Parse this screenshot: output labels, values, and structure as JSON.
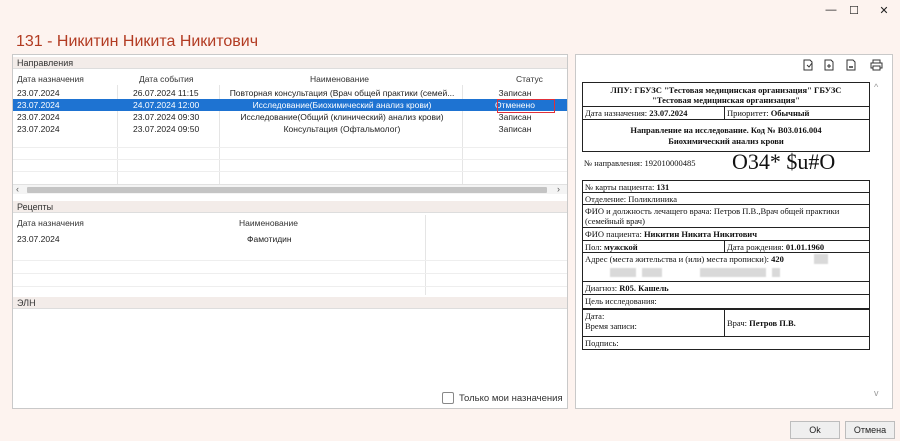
{
  "window": {
    "minimize_icon": "—",
    "maximize_icon": "☐",
    "close_icon": "✕"
  },
  "page_title": "131 - Никитин Никита Никитович",
  "referrals": {
    "section_title": "Направления",
    "columns": [
      "Дата назначения",
      "Дата события",
      "Наименование",
      "Статус"
    ],
    "rows": [
      {
        "assigned": "23.07.2024",
        "event": "26.07.2024 11:15",
        "name": "Повторная консультация (Врач общей практики (семей...",
        "status": "Записан"
      },
      {
        "assigned": "23.07.2024",
        "event": "24.07.2024 12:00",
        "name": "Исследование(Биохимический анализ крови)",
        "status": "Отменено"
      },
      {
        "assigned": "23.07.2024",
        "event": "23.07.2024 09:30",
        "name": "Исследование(Общий (клинический) анализ крови)",
        "status": "Записан"
      },
      {
        "assigned": "23.07.2024",
        "event": "23.07.2024 09:50",
        "name": "Консультация (Офтальмолог)",
        "status": "Записан"
      }
    ],
    "selected_row": 1
  },
  "prescriptions": {
    "section_title": "Рецепты",
    "columns": [
      "Дата назначения",
      "Наименование"
    ],
    "rows": [
      {
        "assigned": "23.07.2024",
        "name": "Фамотидин"
      }
    ]
  },
  "eln": {
    "section_title": "ЭЛН"
  },
  "only_mine_label": "Только мои назначения",
  "toolbar_icons": [
    "document-icon",
    "export-icon",
    "export-alt-icon",
    "print-icon"
  ],
  "document": {
    "lpu_line1": "ЛПУ: ГБУЗС \"Тестовая медицинская организация\" ГБУЗС",
    "lpu_line2": "\"Тестовая медицинская организация\"",
    "date_label": "Дата назначения:",
    "date_value": "23.07.2024",
    "priority_label": "Приоритет:",
    "priority_value": "Обычный",
    "title_line1": "Направление на исследование. Код № B03.016.004",
    "title_line2": "Биохимический анализ крови",
    "referral_no_label": "№ направления:",
    "referral_no_value": "192010000485",
    "barcode_text": "O34* $u#O",
    "card_label": "№ карты пациента:",
    "card_value": "131",
    "department_label": "Отделение:",
    "department_value": "Поликлиника",
    "doctor_label": "ФИО и должность лечащего врача:",
    "doctor_value_line1": "Петров П.В.,Врач общей практики",
    "doctor_value_line2": "(семейный врач)",
    "patient_label": "ФИО пациента:",
    "patient_value": "Никитин Никита Никитович",
    "sex_label": "Пол:",
    "sex_value": "мужской",
    "dob_label": "Дата рождения:",
    "dob_value": "01.01.1960",
    "address_label": "Адрес (места жительства и (или) места прописки):",
    "address_value": "420",
    "diagnosis_label": "Диагноз:",
    "diagnosis_value": "R05. Кашель",
    "goal_label": "Цель исследования:",
    "visit_date_label": "Дата:",
    "visit_time_label": "Время записи:",
    "doctor2_label": "Врач:",
    "doctor2_value": "Петров П.В.",
    "signature_label": "Подпись:"
  },
  "buttons": {
    "ok": "Ok",
    "cancel": "Отмена"
  }
}
